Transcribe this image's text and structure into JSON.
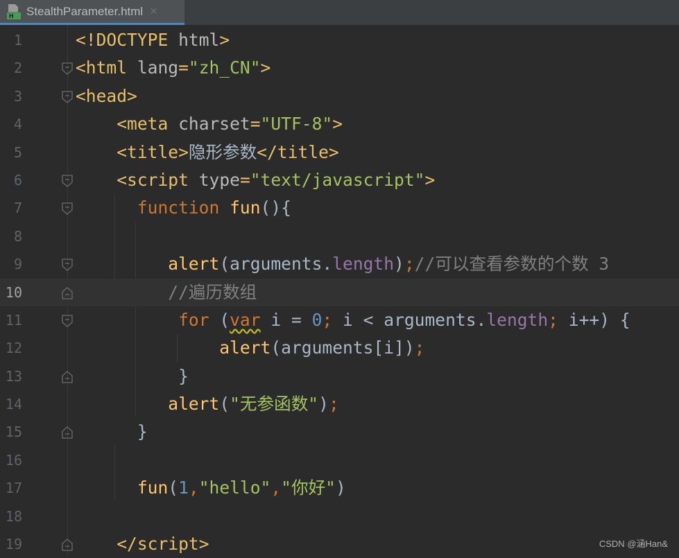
{
  "tab": {
    "title": "StealthParameter.html",
    "icon_label": "H",
    "close": "×"
  },
  "watermark": "CSDN @涵Han&",
  "current_line": 10,
  "lines": [
    {
      "n": "1",
      "fold": "",
      "tokens": [
        [
          "tag",
          "<!DOCTYPE "
        ],
        [
          "attr",
          "html"
        ],
        [
          "tag",
          ">"
        ]
      ]
    },
    {
      "n": "2",
      "fold": "open",
      "tokens": [
        [
          "tag",
          "<html "
        ],
        [
          "attr",
          "lang"
        ],
        [
          "tag",
          "="
        ],
        [
          "str",
          "\"zh_CN\""
        ],
        [
          "tag",
          ">"
        ]
      ]
    },
    {
      "n": "3",
      "fold": "open",
      "tokens": [
        [
          "tag",
          "<head>"
        ]
      ]
    },
    {
      "n": "4",
      "fold": "",
      "tokens": [
        [
          "txt",
          "    "
        ],
        [
          "tag",
          "<meta "
        ],
        [
          "attr",
          "charset"
        ],
        [
          "tag",
          "="
        ],
        [
          "str",
          "\"UTF-8\""
        ],
        [
          "tag",
          ">"
        ]
      ]
    },
    {
      "n": "5",
      "fold": "",
      "tokens": [
        [
          "txt",
          "    "
        ],
        [
          "tag",
          "<title>"
        ],
        [
          "txt",
          "隐形参数"
        ],
        [
          "tag",
          "</title>"
        ]
      ]
    },
    {
      "n": "6",
      "fold": "open",
      "tokens": [
        [
          "txt",
          "    "
        ],
        [
          "tag",
          "<script "
        ],
        [
          "attr",
          "type"
        ],
        [
          "tag",
          "="
        ],
        [
          "str",
          "\"text/javascript\""
        ],
        [
          "tag",
          ">"
        ]
      ]
    },
    {
      "n": "7",
      "fold": "open",
      "tokens": [
        [
          "txt",
          "      "
        ],
        [
          "kw",
          "function "
        ],
        [
          "fn",
          "fun"
        ],
        [
          "punc",
          "(){"
        ]
      ]
    },
    {
      "n": "8",
      "fold": "",
      "tokens": []
    },
    {
      "n": "9",
      "fold": "open",
      "tokens": [
        [
          "txt",
          "         "
        ],
        [
          "fn",
          "alert"
        ],
        [
          "punc",
          "("
        ],
        [
          "txt",
          "arguments."
        ],
        [
          "prop",
          "length"
        ],
        [
          "punc",
          ")"
        ],
        [
          "kw",
          ";"
        ],
        [
          "cmt",
          "//可以查看参数的个数 3"
        ]
      ]
    },
    {
      "n": "10",
      "fold": "close",
      "tokens": [
        [
          "txt",
          "         "
        ],
        [
          "cmt",
          "//遍历数组"
        ]
      ]
    },
    {
      "n": "11",
      "fold": "open",
      "tokens": [
        [
          "txt",
          "          "
        ],
        [
          "kw",
          "for "
        ],
        [
          "punc",
          "("
        ],
        [
          "kwwarn",
          "var"
        ],
        [
          "txt",
          " i = "
        ],
        [
          "num",
          "0"
        ],
        [
          "kw",
          "; "
        ],
        [
          "txt",
          "i < arguments."
        ],
        [
          "prop",
          "length"
        ],
        [
          "kw",
          "; "
        ],
        [
          "txt",
          "i++) {"
        ]
      ]
    },
    {
      "n": "12",
      "fold": "",
      "tokens": [
        [
          "txt",
          "              "
        ],
        [
          "fn",
          "alert"
        ],
        [
          "punc",
          "("
        ],
        [
          "txt",
          "arguments[i])"
        ],
        [
          "kw",
          ";"
        ]
      ]
    },
    {
      "n": "13",
      "fold": "close",
      "tokens": [
        [
          "txt",
          "          }"
        ]
      ]
    },
    {
      "n": "14",
      "fold": "",
      "tokens": [
        [
          "txt",
          "         "
        ],
        [
          "fn",
          "alert"
        ],
        [
          "punc",
          "("
        ],
        [
          "str",
          "\"无参函数\""
        ],
        [
          "punc",
          ")"
        ],
        [
          "kw",
          ";"
        ]
      ]
    },
    {
      "n": "15",
      "fold": "close",
      "tokens": [
        [
          "txt",
          "      }"
        ]
      ]
    },
    {
      "n": "16",
      "fold": "",
      "tokens": []
    },
    {
      "n": "17",
      "fold": "",
      "tokens": [
        [
          "txt",
          "      "
        ],
        [
          "fn",
          "fun"
        ],
        [
          "punc",
          "("
        ],
        [
          "num",
          "1"
        ],
        [
          "kw",
          ","
        ],
        [
          "str",
          "\"hello\""
        ],
        [
          "kw",
          ","
        ],
        [
          "str",
          "\"你好\""
        ],
        [
          "punc",
          ")"
        ]
      ]
    },
    {
      "n": "18",
      "fold": "",
      "tokens": []
    },
    {
      "n": "19",
      "fold": "close",
      "tokens": [
        [
          "txt",
          "    "
        ],
        [
          "tag",
          "</script>"
        ]
      ]
    }
  ]
}
